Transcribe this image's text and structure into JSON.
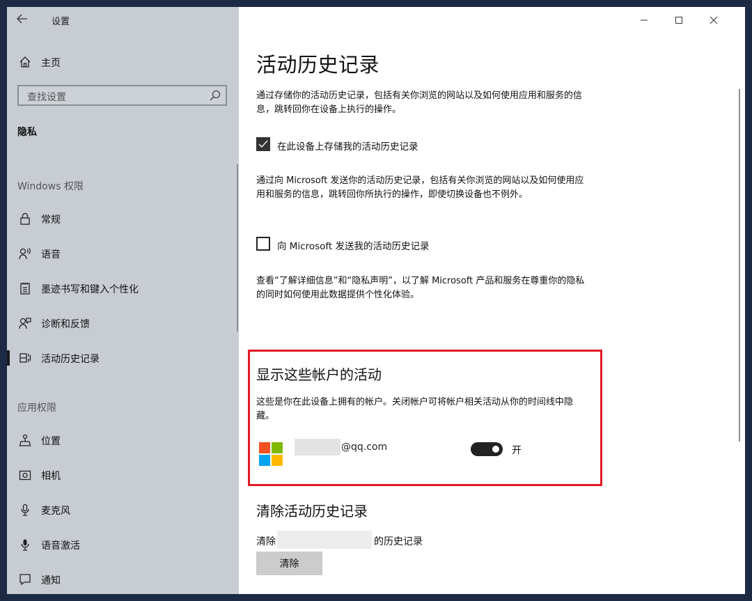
{
  "window": {
    "title": "设置",
    "controls": {
      "minimize": "—",
      "maximize": "☐",
      "close": "✕"
    }
  },
  "sidebar": {
    "home_label": "主页",
    "search_placeholder": "查找设置",
    "current_section": "隐私",
    "groups": [
      {
        "header": "Windows 权限",
        "items": [
          {
            "label": "常规",
            "icon": "lock-icon"
          },
          {
            "label": "语音",
            "icon": "speech-icon"
          },
          {
            "label": "墨迹书写和键入个性化",
            "icon": "notepad-icon"
          },
          {
            "label": "诊断和反馈",
            "icon": "feedback-icon"
          },
          {
            "label": "活动历史记录",
            "icon": "timeline-icon",
            "active": true
          }
        ]
      },
      {
        "header": "应用权限",
        "items": [
          {
            "label": "位置",
            "icon": "location-icon"
          },
          {
            "label": "相机",
            "icon": "camera-icon"
          },
          {
            "label": "麦克风",
            "icon": "microphone-icon"
          },
          {
            "label": "语音激活",
            "icon": "voice-activation-icon"
          },
          {
            "label": "通知",
            "icon": "notification-icon"
          }
        ]
      }
    ]
  },
  "main": {
    "title": "活动历史记录",
    "intro": "通过存储你的活动历史记录，包括有关你浏览的网站以及如何使用应用和服务的信息，跳转回你在设备上执行的操作。",
    "store_checkbox": {
      "label": "在此设备上存储我的活动历史记录",
      "checked": true
    },
    "send_description": "通过向 Microsoft 发送你的活动历史记录，包括有关你浏览的网站以及如何使用应用和服务的信息，跳转回你所执行的操作，即使切换设备也不例外。",
    "send_checkbox": {
      "label": "向 Microsoft 发送我的活动历史记录",
      "checked": false
    },
    "privacy_note": "查看“了解详细信息”和“隐私声明”，以了解 Microsoft 产品和服务在尊重你的隐私的同时如何使用此数据提供个性化体验。",
    "accounts": {
      "title": "显示这些帐户的活动",
      "description": "这些是你在此设备上拥有的帐户。关闭帐户可将帐户相关活动从你的时间线中隐藏。",
      "account": {
        "email_suffix": "@qq.com",
        "toggle_state": "开",
        "toggle_on": true
      },
      "highlight_color": "#e01b24"
    },
    "clear": {
      "title": "清除活动历史记录",
      "prefix": "清除",
      "suffix": "的历史记录",
      "button_label": "清除"
    }
  }
}
